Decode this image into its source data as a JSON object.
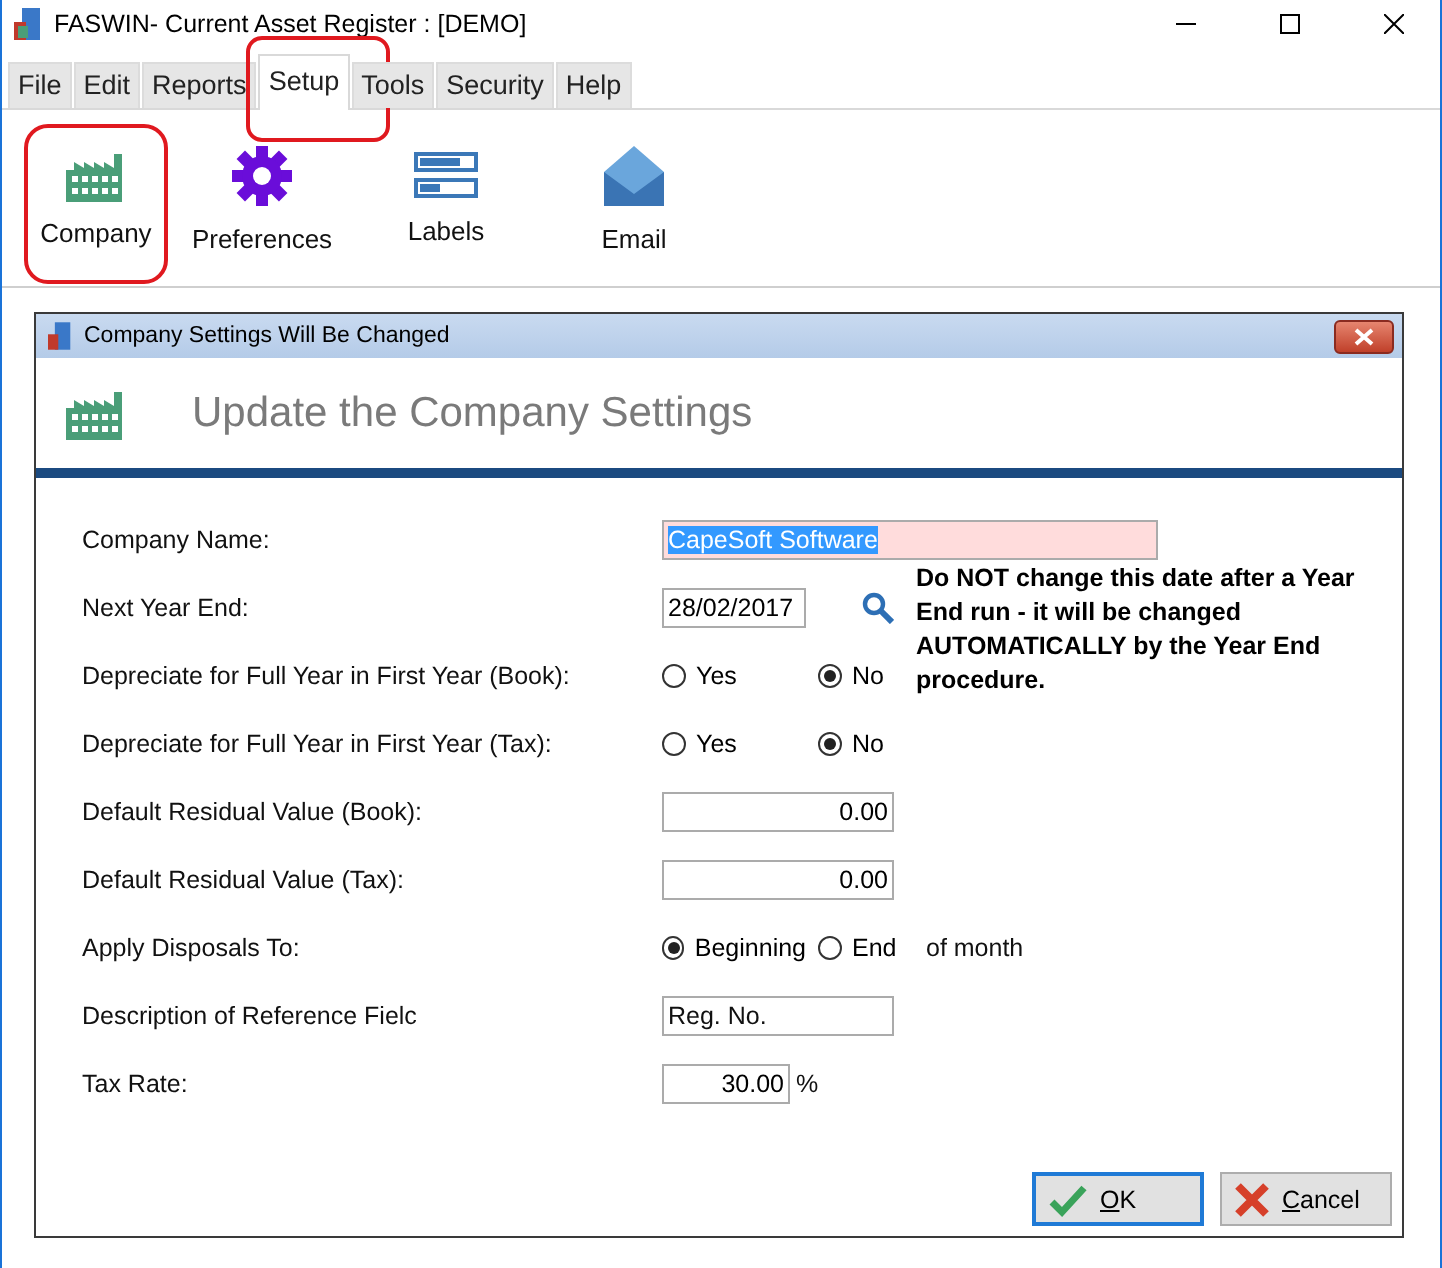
{
  "window": {
    "title": "FASWIN- Current Asset Register : [DEMO]"
  },
  "tabs": [
    {
      "label": "File",
      "selected": false,
      "highlighted": false
    },
    {
      "label": "Edit",
      "selected": false,
      "highlighted": false
    },
    {
      "label": "Reports",
      "selected": false,
      "highlighted": false
    },
    {
      "label": "Setup",
      "selected": true,
      "highlighted": true
    },
    {
      "label": "Tools",
      "selected": false,
      "highlighted": false
    },
    {
      "label": "Security",
      "selected": false,
      "highlighted": false
    },
    {
      "label": "Help",
      "selected": false,
      "highlighted": false
    }
  ],
  "toolbar": [
    {
      "kind": "factory",
      "label": "Company",
      "highlighted": true
    },
    {
      "kind": "gear",
      "label": "Preferences",
      "highlighted": false
    },
    {
      "kind": "labels",
      "label": "Labels",
      "highlighted": false
    },
    {
      "kind": "mail",
      "label": "Email",
      "highlighted": false
    }
  ],
  "dialog": {
    "title": "Company Settings Will Be Changed",
    "heading": "Update the Company Settings",
    "note": "Do NOT change this date after a Year End run - it will be changed AUTOMATICALLY by the Year End procedure.",
    "fields": [
      {
        "kind": "text",
        "label": "Company Name:",
        "value": "CapeSoft Software",
        "selected": true
      },
      {
        "kind": "date",
        "label": "Next Year End:",
        "value": "28/02/2017"
      },
      {
        "kind": "radio",
        "label": "Depreciate for Full Year in First Year (Book):",
        "options": [
          {
            "label": "Yes",
            "selected": false
          },
          {
            "label": "No",
            "selected": true
          }
        ]
      },
      {
        "kind": "radio",
        "label": "Depreciate for Full Year in First Year (Tax):",
        "options": [
          {
            "label": "Yes",
            "selected": false
          },
          {
            "label": "No",
            "selected": true
          }
        ]
      },
      {
        "kind": "number",
        "label": "Default Residual Value (Book):",
        "value": "0.00"
      },
      {
        "kind": "number",
        "label": "Default Residual Value (Tax):",
        "value": "0.00"
      },
      {
        "kind": "radio",
        "label": "Apply Disposals To:",
        "options": [
          {
            "label": "Beginning",
            "selected": true
          },
          {
            "label": "End",
            "selected": false
          }
        ],
        "suffix": "of month"
      },
      {
        "kind": "text",
        "label": "Description of Reference Fielc",
        "value": "Reg. No.",
        "selected": false
      },
      {
        "kind": "percent",
        "label": "Tax Rate:",
        "value": "30.00",
        "suffix": "%"
      }
    ],
    "buttons": [
      {
        "kind": "ok",
        "label": "OK",
        "default": true
      },
      {
        "kind": "cancel",
        "label": "Cancel",
        "default": false
      }
    ]
  }
}
